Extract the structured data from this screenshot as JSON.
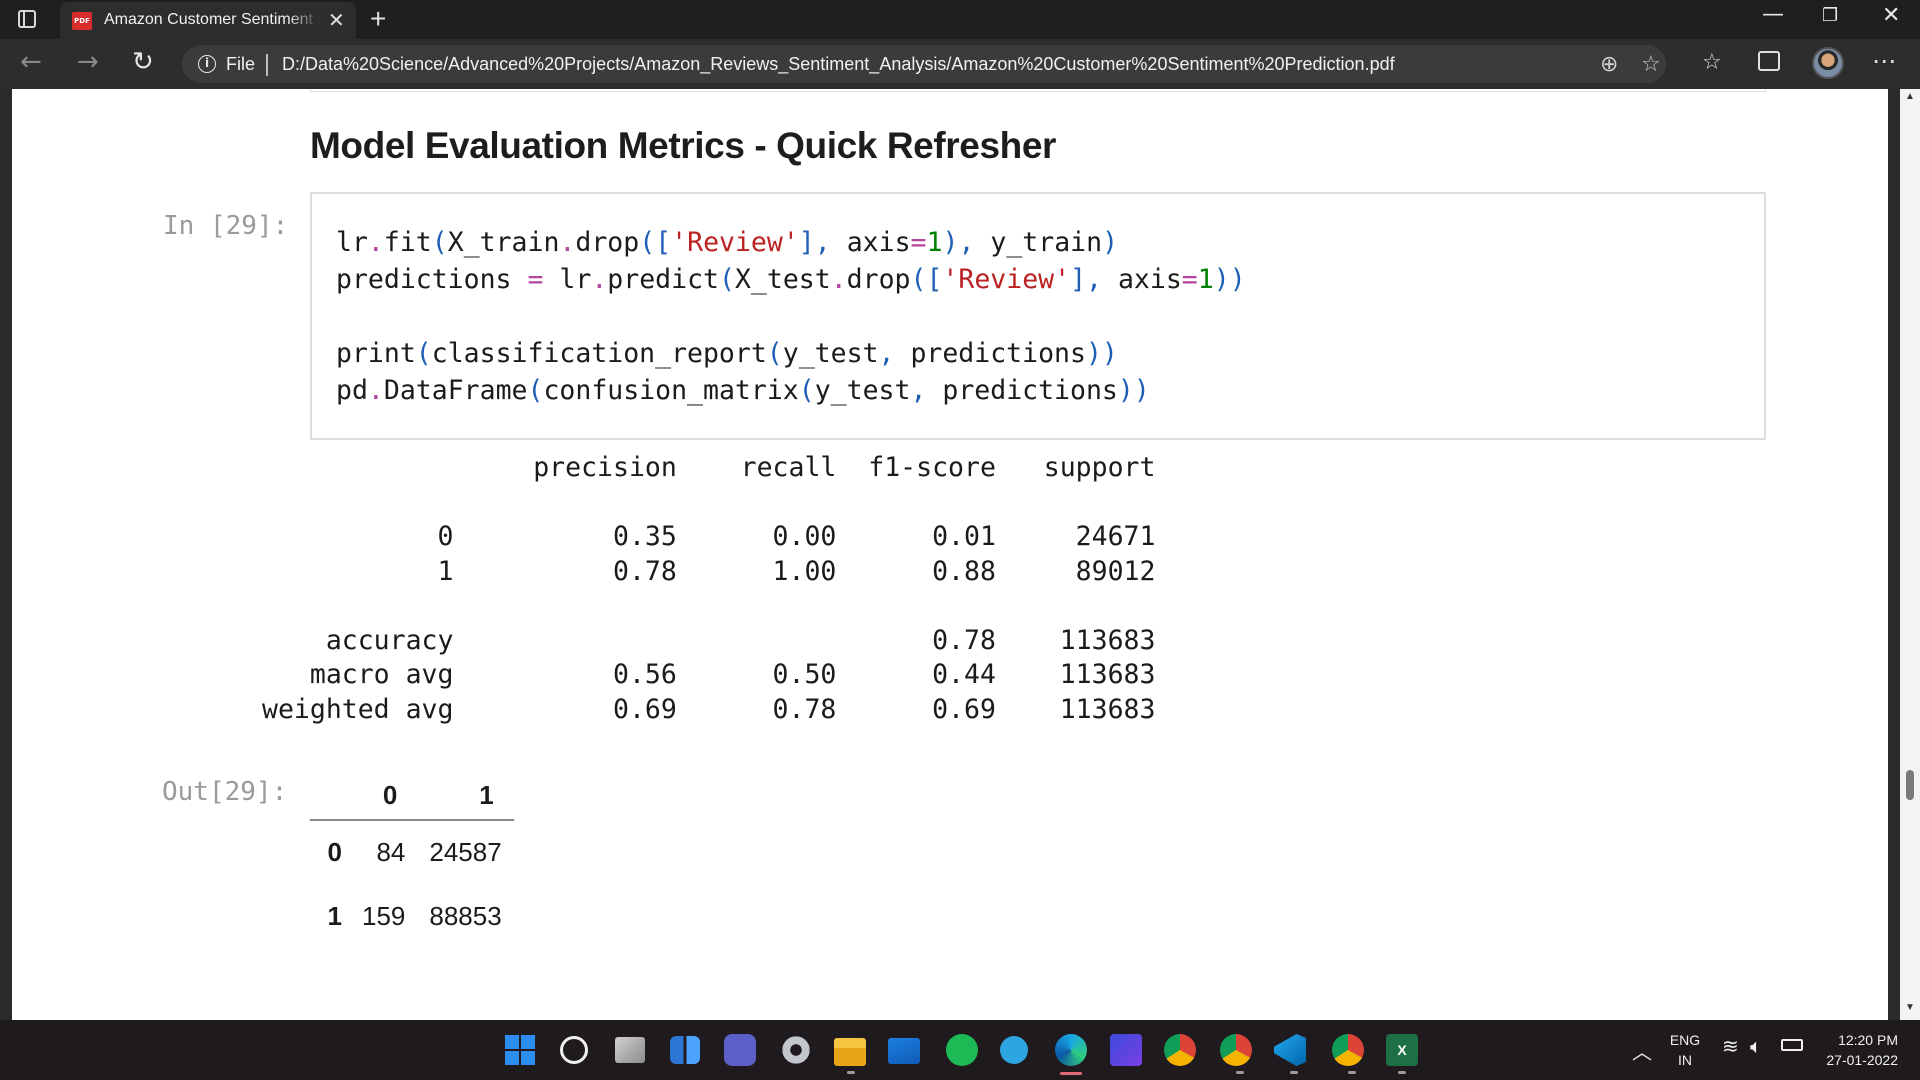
{
  "browser": {
    "tab_title": "Amazon Customer Sentiment Prediction.pdf",
    "tab_favicon_text": "PDF",
    "tab_close_glyph": "✕",
    "new_tab_glyph": "+",
    "address": {
      "scheme_label": "File",
      "url": "D:/Data%20Science/Advanced%20Projects/Amazon_Reviews_Sentiment_Analysis/Amazon%20Customer%20Sentiment%20Prediction.pdf"
    },
    "icons": {
      "tab_actions": "tab-actions-icon",
      "back": "back-arrow-icon",
      "forward": "forward-arrow-icon",
      "reload": "reload-icon",
      "info": "info-icon",
      "zoom": "zoom-icon",
      "add_favorite": "add-favorite-icon",
      "favorites": "favorites-icon",
      "collections": "collections-icon",
      "more": "more-icon"
    }
  },
  "notebook": {
    "heading": "Model Evaluation Metrics - Quick Refresher",
    "in_prompt": "In [29]:",
    "out_prompt": "Out[29]:",
    "code_lines": [
      "lr.fit(X_train.drop(['Review'], axis=1), y_train)",
      "predictions = lr.predict(X_test.drop(['Review'], axis=1))",
      "",
      "print(classification_report(y_test, predictions))",
      "pd.DataFrame(confusion_matrix(y_test, predictions))"
    ],
    "classification_report": {
      "headers": [
        "precision",
        "recall",
        "f1-score",
        "support"
      ],
      "rows": [
        {
          "label": "0",
          "precision": "0.35",
          "recall": "0.00",
          "f1": "0.01",
          "support": "24671"
        },
        {
          "label": "1",
          "precision": "0.78",
          "recall": "1.00",
          "f1": "0.88",
          "support": "89012"
        },
        {
          "label": "accuracy",
          "precision": "",
          "recall": "",
          "f1": "0.78",
          "support": "113683"
        },
        {
          "label": "macro avg",
          "precision": "0.56",
          "recall": "0.50",
          "f1": "0.44",
          "support": "113683"
        },
        {
          "label": "weighted avg",
          "precision": "0.69",
          "recall": "0.78",
          "f1": "0.69",
          "support": "113683"
        }
      ]
    },
    "confusion_matrix": {
      "columns": [
        "0",
        "1"
      ],
      "rows": [
        {
          "index": "0",
          "values": [
            "84",
            "24587"
          ]
        },
        {
          "index": "1",
          "values": [
            "159",
            "88853"
          ]
        }
      ]
    }
  },
  "taskbar": {
    "apps": [
      "start",
      "search",
      "task-view",
      "widgets",
      "teams",
      "settings",
      "file-explorer",
      "mail",
      "spotify",
      "telegram",
      "edge",
      "toolbox",
      "chrome",
      "chrome",
      "vscode",
      "chrome",
      "excel"
    ],
    "excel_letter": "X",
    "tray": {
      "lang_line1": "ENG",
      "lang_line2": "IN",
      "time": "12:20 PM",
      "date": "27-01-2022"
    }
  }
}
